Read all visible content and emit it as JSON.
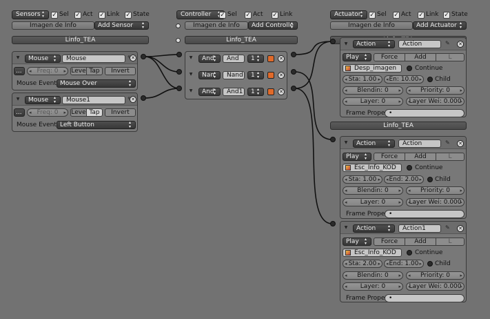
{
  "header": {
    "sensors_menu": "Sensors",
    "controller_menu": "Controller",
    "actuator_menu": "Actuator",
    "sel": "Sel",
    "act": "Act",
    "link": "Link",
    "state": "State",
    "imagen_info": "Imagen de Info",
    "add_sensor": "Add Sensor",
    "add_controller": "Add Controlle",
    "add_actuator": "Add Actuator",
    "object_name": "Linfo_TEA"
  },
  "sensors": [
    {
      "type": "Mouse",
      "name": "Mouse",
      "freq": "Freq: 0",
      "level": "Leve",
      "tap": "Tap",
      "invert": "Invert",
      "event_label": "Mouse Event:",
      "event": "Mouse Over"
    },
    {
      "type": "Mouse",
      "name": "Mouse1",
      "freq": "Freq: 0",
      "level": "Leve",
      "tap": "Tap",
      "invert": "Invert",
      "event_label": "Mouse Event:",
      "event": "Left Button"
    }
  ],
  "sensor_dots": "...",
  "controllers": [
    {
      "type": "And",
      "name": "And",
      "state": "1"
    },
    {
      "type": "Nan",
      "name": "Nand",
      "state": "1"
    },
    {
      "type": "And",
      "name": "And1",
      "state": "1"
    }
  ],
  "actuators": [
    {
      "type": "Action",
      "name": "Action",
      "play": "Play",
      "force": "Force",
      "add": "Add",
      "l": "L",
      "action_name": "Desp_imagen",
      "continue": "Continue",
      "sta": "Sta: 1.00",
      "end": "En: 10.00",
      "child": "Child",
      "blendin": "Blendin: 0",
      "priority": "Priority: 0",
      "layer": "Layer: 0",
      "layer_weight": "Layer Wei: 0.000",
      "frame_prop": "Frame Prope"
    },
    {
      "type": "Action",
      "name": "Action",
      "play": "Play",
      "force": "Force",
      "add": "Add",
      "l": "L",
      "action_name": "Esc_Info_KOD",
      "continue": "Continue",
      "sta": "Sta: 1.00",
      "end": "End: 2.00",
      "child": "Child",
      "blendin": "Blendin: 0",
      "priority": "Priority: 0",
      "layer": "Layer: 0",
      "layer_weight": "Layer Wei: 0.000",
      "frame_prop": "Frame Prope"
    },
    {
      "type": "Action",
      "name": "Action1",
      "play": "Play",
      "force": "Force",
      "add": "Add",
      "l": "L",
      "action_name": "Esc_Info_KOD",
      "continue": "Continue",
      "sta": "Sta: 2.00",
      "end": "End: 1.00",
      "child": "Child",
      "blendin": "Blendin: 0",
      "priority": "Priority: 0",
      "layer": "Layer: 0",
      "layer_weight": "Layer Wei: 0.000",
      "frame_prop": "Frame Prope"
    }
  ],
  "actuator_object_name": "Linfo_TEA",
  "colors": {
    "background": "#727272",
    "panel": "#787878",
    "dark_button": "#3a3a3a",
    "field": "#c6c6c6",
    "controller_icon": "#e06a2a"
  }
}
